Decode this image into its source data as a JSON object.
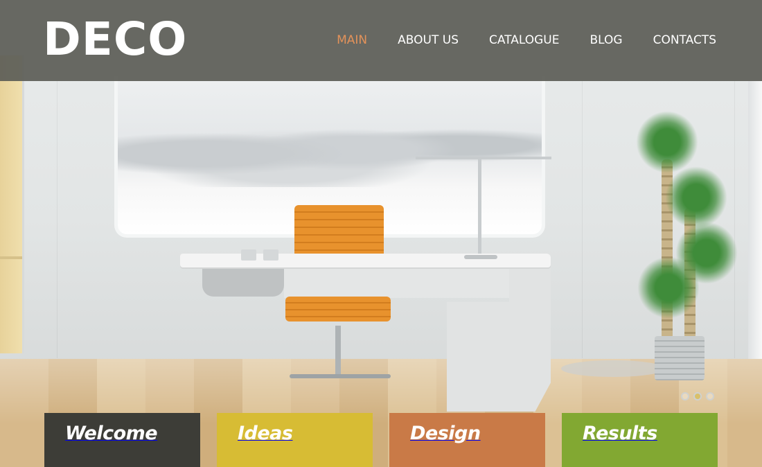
{
  "header": {
    "logo": "DECO",
    "nav": [
      {
        "label": "MAIN",
        "active": true
      },
      {
        "label": "ABOUT US",
        "active": false
      },
      {
        "label": "CATALOGUE",
        "active": false
      },
      {
        "label": "BLOG",
        "active": false
      },
      {
        "label": "CONTACTS",
        "active": false
      }
    ]
  },
  "slider": {
    "dots": 3,
    "active_dot": 2
  },
  "tiles": [
    {
      "label": "Welcome",
      "color": "#3d3d37"
    },
    {
      "label": "Ideas",
      "color": "#d7bc34"
    },
    {
      "label": "Design",
      "color": "#c97a47"
    },
    {
      "label": "Results",
      "color": "#82a832"
    }
  ],
  "colors": {
    "header_bg": "#5d5e58",
    "nav_active": "#e3925a",
    "nav_text": "#ffffff"
  }
}
